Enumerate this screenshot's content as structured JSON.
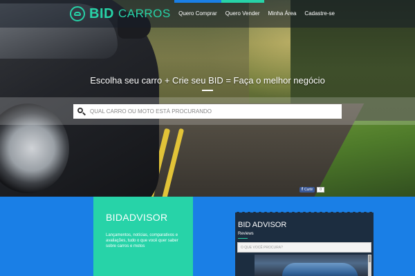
{
  "brand": {
    "name_bold": "BID",
    "name_rest": "CARROS"
  },
  "nav": {
    "items": [
      {
        "label": "Quero Comprar",
        "accent": "#1a7fe6"
      },
      {
        "label": "Quero Vender",
        "accent": "#27d3a8"
      },
      {
        "label": "Minha Área"
      },
      {
        "label": "Cadastre-se"
      }
    ]
  },
  "hero": {
    "headline": "Escolha seu carro + Crie seu BID = Faça o melhor negócio",
    "search_placeholder": "QUAL CARRO OU MOTO ESTÁ PROCURANDO"
  },
  "social": {
    "fb_label": "Curtir",
    "count": "0"
  },
  "bidadvisor": {
    "title": "BIDADVISOR",
    "text": "Lançamentos, notícias, comparativos e avaliações, tudo o que você quer saber sobre carros e motos"
  },
  "review_widget": {
    "title": "BID ADVISOR",
    "subtitle": "Reviews",
    "search_placeholder": "O QUE VOCÊ PROCURA?"
  },
  "colors": {
    "accent_blue": "#1a7fe6",
    "accent_green": "#27d3a8",
    "widget_bg": "#1c2d40"
  },
  "icons": [
    "car-logo-icon",
    "search-icon",
    "facebook-icon"
  ]
}
